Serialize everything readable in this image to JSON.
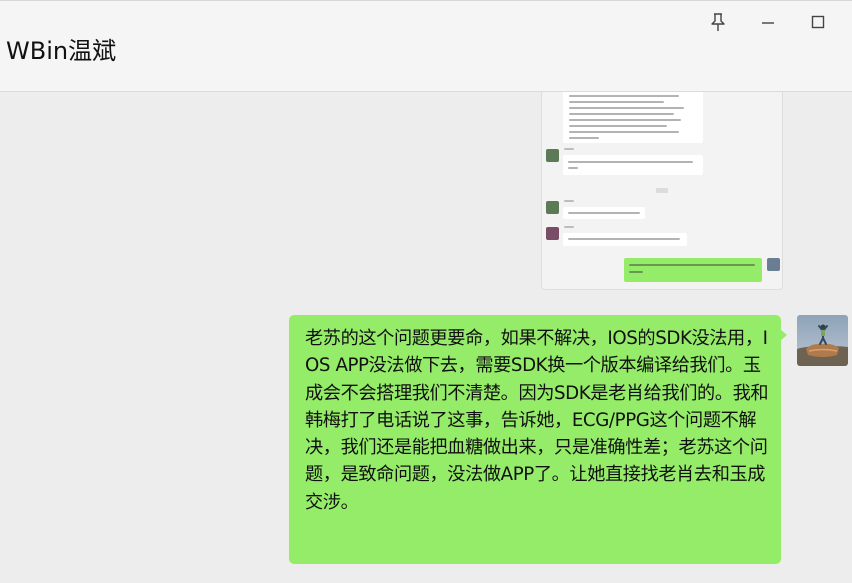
{
  "window": {
    "title": "WBin温斌",
    "controls": {
      "pin_icon": "pin-icon",
      "minimize_icon": "minimize-icon",
      "maximize_icon": "maximize-icon"
    }
  },
  "messages": [
    {
      "type": "image",
      "sender": "self",
      "description_icon": "chat-screenshot-image"
    },
    {
      "type": "text",
      "sender": "self",
      "text": "老苏的这个问题更要命，如果不解决，IOS的SDK没法用，IOS APP没法做下去，需要SDK换一个版本编译给我们。玉成会不会搭理我们不清楚。因为SDK是老肖给我们的。我和韩梅打了电话说了这事，告诉她，ECG/PPG这个问题不解决，我们还是能把血糖做出来，只是准确性差；老苏这个问题，是致命问题，没法做APP了。让她直接找老肖去和玉成交涉。"
    }
  ],
  "colors": {
    "self_bubble": "#95ec69",
    "background": "#ededed",
    "titlebar": "#f5f5f5"
  }
}
